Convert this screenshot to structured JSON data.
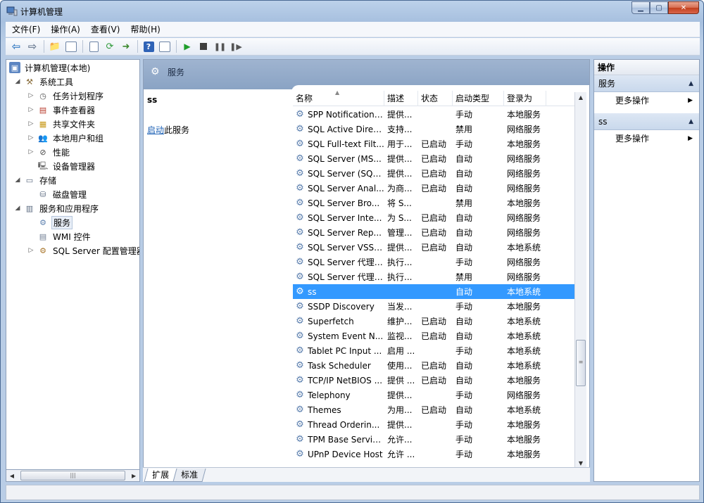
{
  "window": {
    "title": "计算机管理"
  },
  "menu": [
    "文件(F)",
    "操作(A)",
    "查看(V)",
    "帮助(H)"
  ],
  "tree": {
    "root": "计算机管理(本地)",
    "system_tools": "系统工具",
    "task_scheduler": "任务计划程序",
    "event_viewer": "事件查看器",
    "shared_folders": "共享文件夹",
    "local_users": "本地用户和组",
    "performance": "性能",
    "device_manager": "设备管理器",
    "storage": "存储",
    "disk_management": "磁盘管理",
    "services_apps": "服务和应用程序",
    "services": "服务",
    "wmi": "WMI 控件",
    "sql_config": "SQL Server 配置管理器"
  },
  "center": {
    "header_title": "服务",
    "selected_name": "ss",
    "start_link": "启动",
    "start_suffix": "此服务",
    "columns": {
      "name": "名称",
      "desc": "描述",
      "status": "状态",
      "startup": "启动类型",
      "logon": "登录为"
    },
    "rows": [
      {
        "name": "SPP Notification ...",
        "desc": "提供...",
        "status": "",
        "startup": "手动",
        "logon": "本地服务"
      },
      {
        "name": "SQL Active Direc...",
        "desc": "支持...",
        "status": "",
        "startup": "禁用",
        "logon": "网络服务"
      },
      {
        "name": "SQL Full-text Filt...",
        "desc": "用于...",
        "status": "已启动",
        "startup": "手动",
        "logon": "本地服务"
      },
      {
        "name": "SQL Server (MS...",
        "desc": "提供...",
        "status": "已启动",
        "startup": "自动",
        "logon": "网络服务"
      },
      {
        "name": "SQL Server (SQL...",
        "desc": "提供...",
        "status": "已启动",
        "startup": "自动",
        "logon": "网络服务"
      },
      {
        "name": "SQL Server Anal...",
        "desc": "为商...",
        "status": "已启动",
        "startup": "自动",
        "logon": "网络服务"
      },
      {
        "name": "SQL Server Bro...",
        "desc": "将 S...",
        "status": "",
        "startup": "禁用",
        "logon": "本地服务"
      },
      {
        "name": "SQL Server Inte...",
        "desc": "为 S...",
        "status": "已启动",
        "startup": "自动",
        "logon": "网络服务"
      },
      {
        "name": "SQL Server Rep...",
        "desc": "管理...",
        "status": "已启动",
        "startup": "自动",
        "logon": "网络服务"
      },
      {
        "name": "SQL Server VSS ...",
        "desc": "提供...",
        "status": "已启动",
        "startup": "自动",
        "logon": "本地系统"
      },
      {
        "name": "SQL Server 代理 ...",
        "desc": "执行...",
        "status": "",
        "startup": "手动",
        "logon": "网络服务"
      },
      {
        "name": "SQL Server 代理 ...",
        "desc": "执行...",
        "status": "",
        "startup": "禁用",
        "logon": "网络服务"
      },
      {
        "name": "ss",
        "desc": "",
        "status": "",
        "startup": "自动",
        "logon": "本地系统",
        "selected": true
      },
      {
        "name": "SSDP Discovery",
        "desc": "当发...",
        "status": "",
        "startup": "手动",
        "logon": "本地服务"
      },
      {
        "name": "Superfetch",
        "desc": "维护...",
        "status": "已启动",
        "startup": "自动",
        "logon": "本地系统"
      },
      {
        "name": "System Event N...",
        "desc": "监视...",
        "status": "已启动",
        "startup": "自动",
        "logon": "本地系统"
      },
      {
        "name": "Tablet PC Input ...",
        "desc": "启用 ...",
        "status": "",
        "startup": "手动",
        "logon": "本地系统"
      },
      {
        "name": "Task Scheduler",
        "desc": "使用...",
        "status": "已启动",
        "startup": "自动",
        "logon": "本地系统"
      },
      {
        "name": "TCP/IP NetBIOS ...",
        "desc": "提供 ...",
        "status": "已启动",
        "startup": "自动",
        "logon": "本地服务"
      },
      {
        "name": "Telephony",
        "desc": "提供...",
        "status": "",
        "startup": "手动",
        "logon": "网络服务"
      },
      {
        "name": "Themes",
        "desc": "为用...",
        "status": "已启动",
        "startup": "自动",
        "logon": "本地系统"
      },
      {
        "name": "Thread Orderin...",
        "desc": "提供...",
        "status": "",
        "startup": "手动",
        "logon": "本地服务"
      },
      {
        "name": "TPM Base Servic...",
        "desc": "允许...",
        "status": "",
        "startup": "手动",
        "logon": "本地服务"
      },
      {
        "name": "UPnP Device Host",
        "desc": "允许 ...",
        "status": "",
        "startup": "手动",
        "logon": "本地服务"
      }
    ],
    "tabs": [
      "扩展",
      "标准"
    ]
  },
  "actions": {
    "title": "操作",
    "section1": "服务",
    "section1_more": "更多操作",
    "section2": "ss",
    "section2_more": "更多操作"
  }
}
